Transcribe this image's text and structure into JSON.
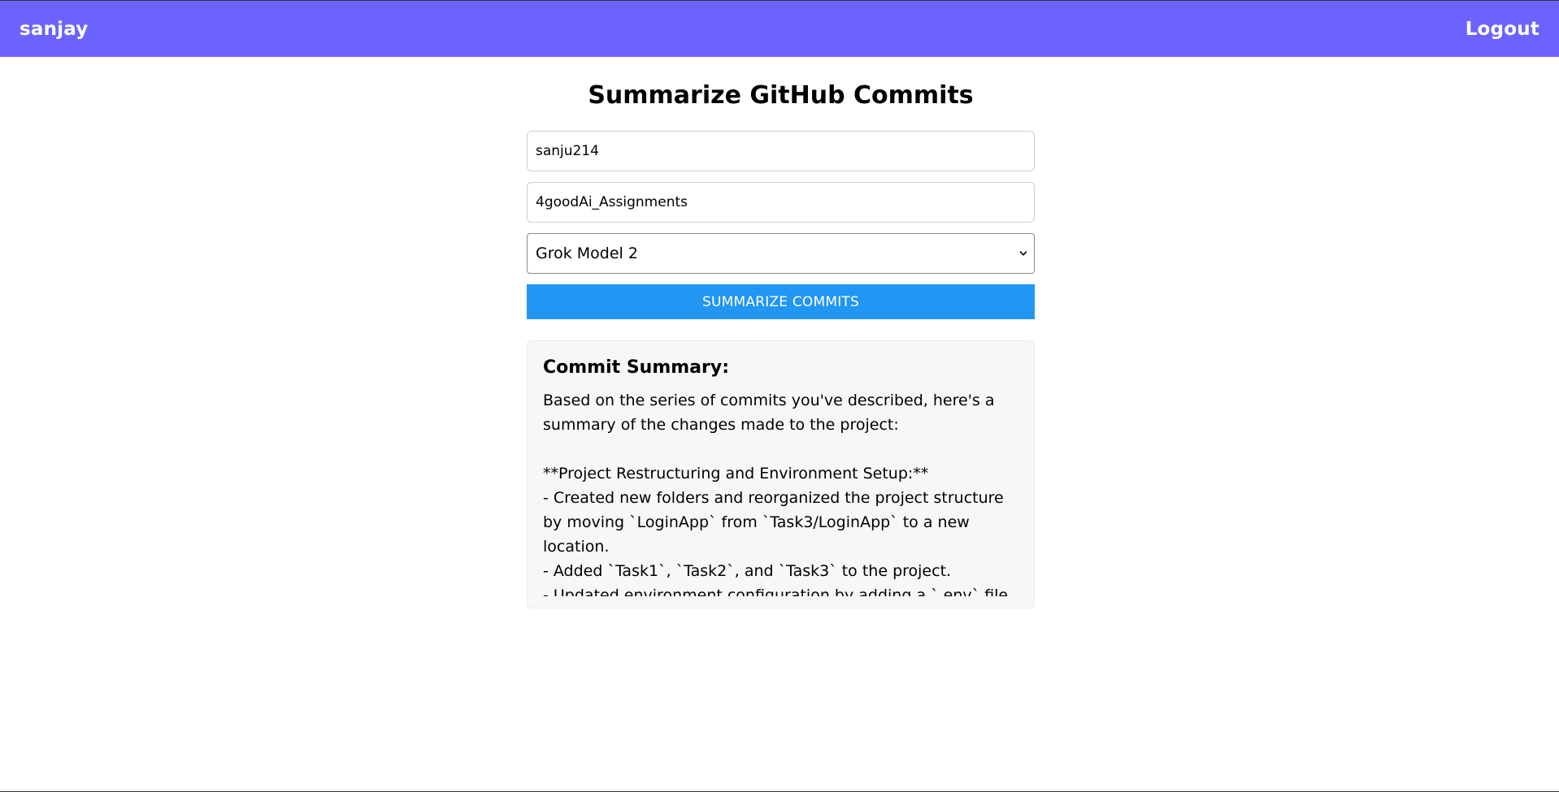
{
  "navbar": {
    "brand": "sanjay",
    "logout_label": "Logout"
  },
  "main": {
    "title": "Summarize GitHub Commits",
    "owner_value": "sanju214",
    "repo_value": "4goodAi_Assignments",
    "model_select": {
      "selected": "Grok Model 2",
      "icon": "chevron-down-icon"
    },
    "submit_label": "SUMMARIZE COMMITS"
  },
  "summary": {
    "heading": "Commit Summary:",
    "text": "Based on the series of commits you've described, here's a summary of the changes made to the project:\n\n**Project Restructuring and Environment Setup:**\n- Created new folders and reorganized the project structure by moving `LoginApp` from `Task3/LoginApp` to a new location.\n- Added `Task1`, `Task2`, and `Task3` to the project.\n- Updated environment configuration by adding a `.env` file and"
  },
  "colors": {
    "navbar": "#6c63ff",
    "button": "#2196f3",
    "card_bg": "#f7f7f7"
  }
}
